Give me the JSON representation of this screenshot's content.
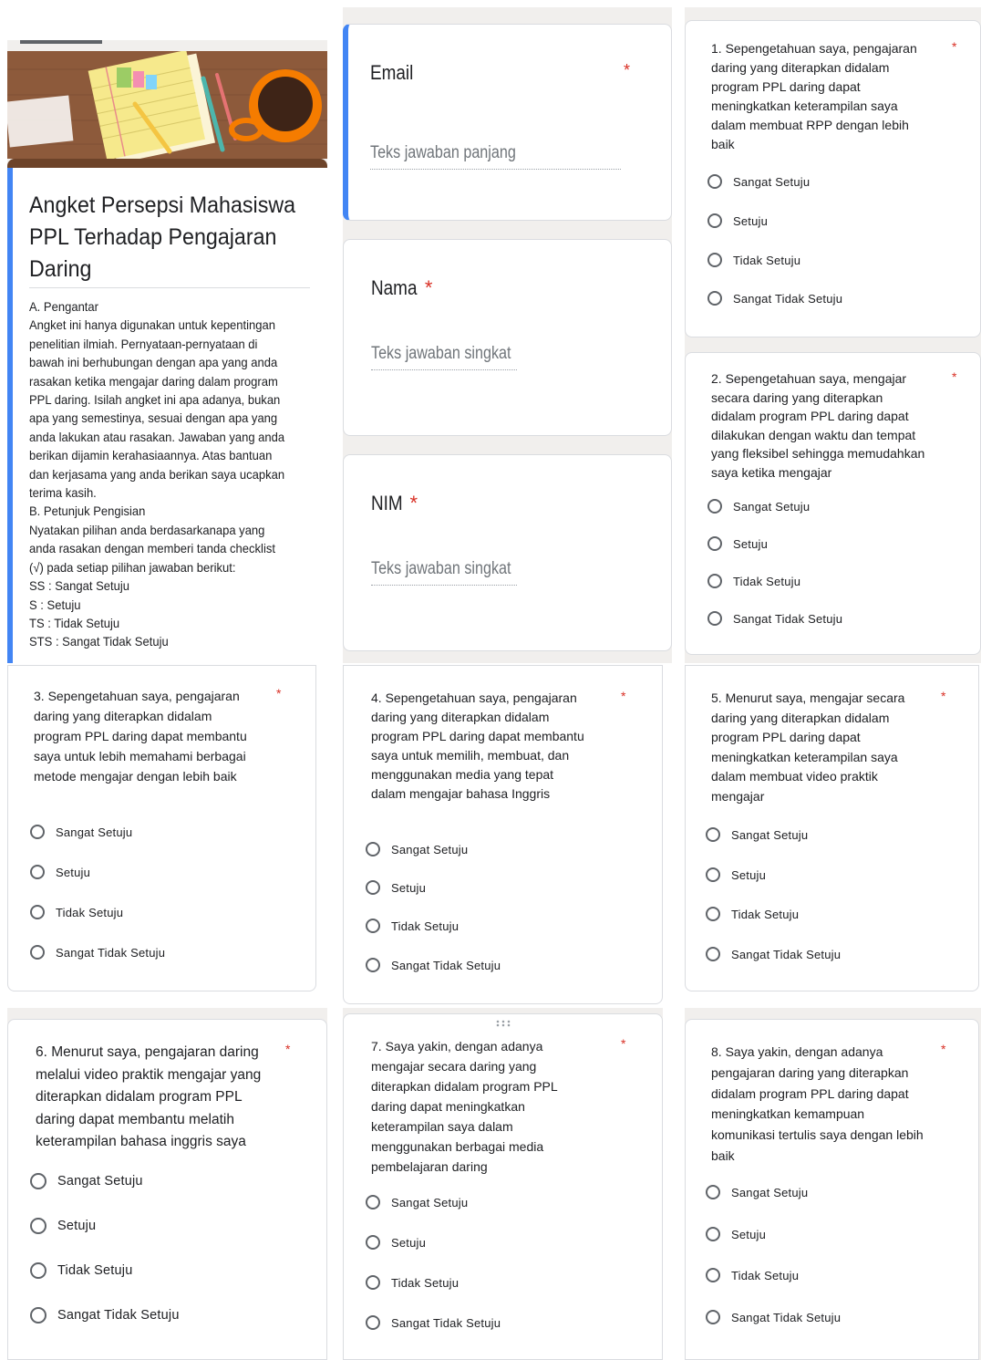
{
  "header": {
    "title_lines": [
      "Angket Persepsi Mahasiswa",
      "PPL Terhadap Pengajaran",
      "Daring"
    ],
    "intro_lines": [
      "A.   Pengantar",
      "Angket ini hanya digunakan untuk kepentingan",
      "penelitian ilmiah. Pernyataan-pernyataan di",
      "bawah ini berhubungan dengan apa yang anda",
      "rasakan ketika mengajar daring dalam program",
      "PPL daring. Isilah angket ini apa adanya, bukan",
      "apa yang semestinya, sesuai dengan apa yang",
      "anda lakukan atau rasakan. Jawaban yang anda",
      "berikan dijamin kerahasiaannya. Atas bantuan",
      "dan kerjasama yang anda berikan saya ucapkan",
      "terima kasih.",
      "B.   Petunjuk Pengisian",
      "Nyatakan pilihan anda berdasarkanapa yang",
      "anda rasakan dengan memberi tanda checklist",
      "(√) pada setiap pilihan jawaban berikut:",
      "SS   : Sangat Setuju",
      "S     : Setuju",
      "TS   : Tidak Setuju",
      "STS : Sangat Tidak Setuju"
    ]
  },
  "required_mark": "*",
  "fields": [
    {
      "label": "Email",
      "placeholder": "Teks jawaban panjang"
    },
    {
      "label": "Nama",
      "placeholder": "Teks jawaban singkat"
    },
    {
      "label": "NIM",
      "placeholder": "Teks jawaban singkat"
    }
  ],
  "options": [
    "Sangat Setuju",
    "Setuju",
    "Tidak Setuju",
    "Sangat Tidak Setuju"
  ],
  "questions": [
    {
      "lines": [
        "1. Sepengetahuan saya, pengajaran",
        "daring yang diterapkan didalam",
        "program PPL daring dapat",
        "meningkatkan keterampilan saya",
        "dalam membuat RPP dengan lebih",
        "baik"
      ]
    },
    {
      "lines": [
        "2. Sepengetahuan saya, mengajar",
        "secara daring yang diterapkan",
        "didalam program PPL daring dapat",
        "dilakukan dengan waktu dan tempat",
        "yang fleksibel sehingga memudahkan",
        "saya ketika mengajar"
      ]
    },
    {
      "lines": [
        "3. Sepengetahuan saya, pengajaran",
        "daring yang diterapkan didalam",
        "program PPL daring dapat membantu",
        "saya untuk lebih memahami berbagai",
        "metode mengajar dengan lebih baik"
      ]
    },
    {
      "lines": [
        "4. Sepengetahuan saya, pengajaran",
        "daring yang diterapkan didalam",
        "program PPL daring dapat membantu",
        "saya untuk memilih, membuat, dan",
        "menggunakan media yang tepat",
        "dalam mengajar bahasa Inggris"
      ]
    },
    {
      "lines": [
        "5. Menurut saya, mengajar secara",
        "daring yang diterapkan didalam",
        "program PPL daring dapat",
        "meningkatkan keterampilan saya",
        "dalam membuat video praktik",
        "mengajar"
      ]
    },
    {
      "lines": [
        "6. Menurut saya, pengajaran daring",
        "melalui video praktik mengajar yang",
        "diterapkan didalam program PPL",
        "daring dapat membantu melatih",
        "keterampilan bahasa inggris saya"
      ]
    },
    {
      "lines": [
        "7. Saya yakin, dengan adanya",
        "mengajar secara daring yang",
        "diterapkan didalam program PPL",
        "daring dapat meningkatkan",
        "keterampilan saya dalam",
        "menggunakan berbagai media",
        "pembelajaran daring"
      ]
    },
    {
      "lines": [
        "8. Saya yakin, dengan adanya",
        "pengajaran daring yang diterapkan",
        "didalam program PPL daring dapat",
        "meningkatkan kemampuan",
        "komunikasi tertulis saya dengan lebih",
        "baik"
      ]
    }
  ],
  "colors": {
    "accent": "#4285f4",
    "required": "#d93025",
    "banner": "#8d5a3b",
    "background": "#f1efed"
  }
}
